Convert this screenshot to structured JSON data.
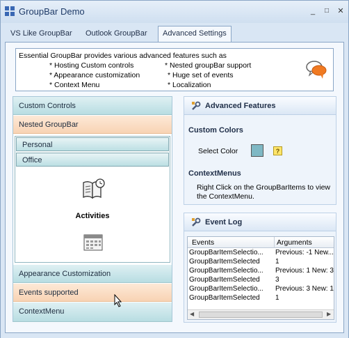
{
  "window": {
    "title": "GroupBar Demo",
    "minimize": "_",
    "maximize": "□",
    "close": "✕"
  },
  "tabs": [
    {
      "label": "VS Like GroupBar"
    },
    {
      "label": "Outlook GroupBar"
    },
    {
      "label": "Advanced Settings"
    }
  ],
  "info": {
    "intro": "Essential GroupBar provides various advanced features such as",
    "features": [
      "* Hosting Custom controls",
      "* Appearance customization",
      "* Context Menu",
      "* Nested groupBar support",
      "* Huge set of events",
      "* Localization"
    ]
  },
  "groupbar": {
    "items": [
      {
        "label": "Custom Controls"
      },
      {
        "label": "Nested GroupBar"
      },
      {
        "label": "Appearance Customization"
      },
      {
        "label": "Events supported"
      },
      {
        "label": "ContextMenu"
      }
    ],
    "nested": {
      "items": [
        {
          "label": "Personal"
        },
        {
          "label": "Office"
        }
      ],
      "activities_label": "Activities"
    }
  },
  "advanced": {
    "title": "Advanced Features",
    "custom_colors": "Custom Colors",
    "select_color": "Select Color",
    "swatch_color": "#7fb8c4",
    "help": "?",
    "context_menus": "ContextMenus",
    "context_text": "Right Click on the GroupBarItems to view the ContextMenu."
  },
  "event_log": {
    "title": "Event Log",
    "columns": [
      "Events",
      "Arguments"
    ],
    "rows": [
      [
        "GroupBarItemSelectio...",
        "Previous: -1 New..."
      ],
      [
        "GroupBarItemSelected",
        "1"
      ],
      [
        "GroupBarItemSelectio...",
        "Previous: 1 New: 3"
      ],
      [
        "GroupBarItemSelected",
        "3"
      ],
      [
        "GroupBarItemSelectio...",
        "Previous: 3 New: 1"
      ],
      [
        "GroupBarItemSelected",
        "1"
      ]
    ],
    "scroll_left": "◀",
    "scroll_right": "▶"
  },
  "colors": {
    "teal_header": "#b8dde2",
    "peach_header": "#f8d3b4",
    "frame": "#8aa6c6"
  }
}
